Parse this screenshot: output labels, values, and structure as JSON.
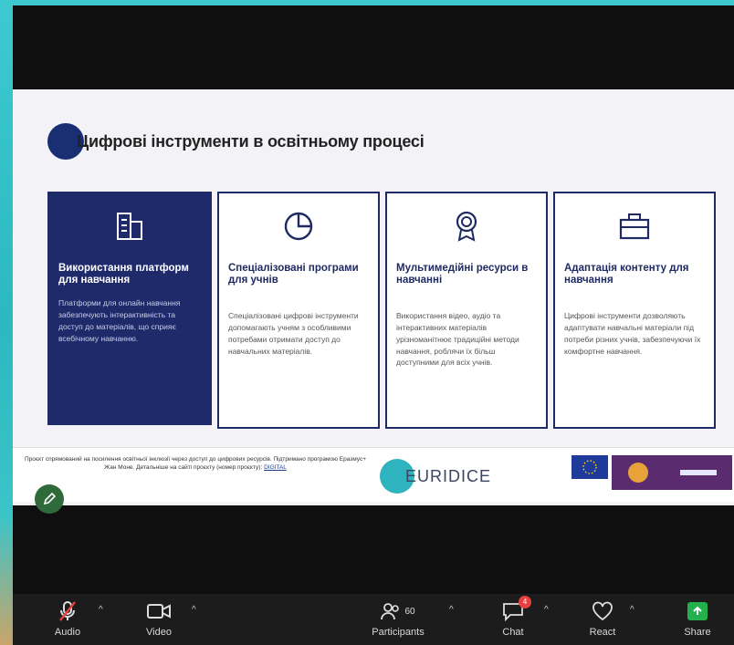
{
  "slide": {
    "title": "Цифрові інструменти в освітньому процесі",
    "cards": [
      {
        "heading": "Використання платформ для навчання",
        "body": "Платформи для онлайн навчання забезпечують інтерактивність та доступ до матеріалів, що сприяє всебічному навчанню."
      },
      {
        "heading": "Спеціалізовані програми для учнів",
        "body": "Спеціалізовані цифрові інструменти допомагають учням з особливими потребами отримати доступ до навчальних матеріалів."
      },
      {
        "heading": "Мультимедійні ресурси в навчанні",
        "body": "Використання відео, аудіо та інтерактивних матеріалів урізноманітнює традиційні методи навчання, роблячи їх більш доступними для всіх учнів."
      },
      {
        "heading": "Адаптація контенту для навчання",
        "body": "Цифрові інструменти дозволяють адаптувати навчальні матеріали під потреби різних учнів, забезпечуючи їх комфортне навчання."
      }
    ],
    "footer_text": "Проєкт спрямований на посилення освітньої інклюзії через доступ до цифрових ресурсів. Підтримано програмою Еразмус+ Жан Моне. Детальніше на сайті проєкту (номер проєкту):",
    "footer_link": "DIGITAL",
    "project_logo_text": "EURIDICE"
  },
  "toolbar": {
    "audio_label": "Audio",
    "video_label": "Video",
    "participants_label": "Participants",
    "participants_count": "60",
    "chat_label": "Chat",
    "chat_badge": "4",
    "react_label": "React",
    "share_label": "Share"
  },
  "colors": {
    "accent_navy": "#1f2a6a",
    "share_green": "#22b14c",
    "teal_bg": "#3ec7cf"
  }
}
